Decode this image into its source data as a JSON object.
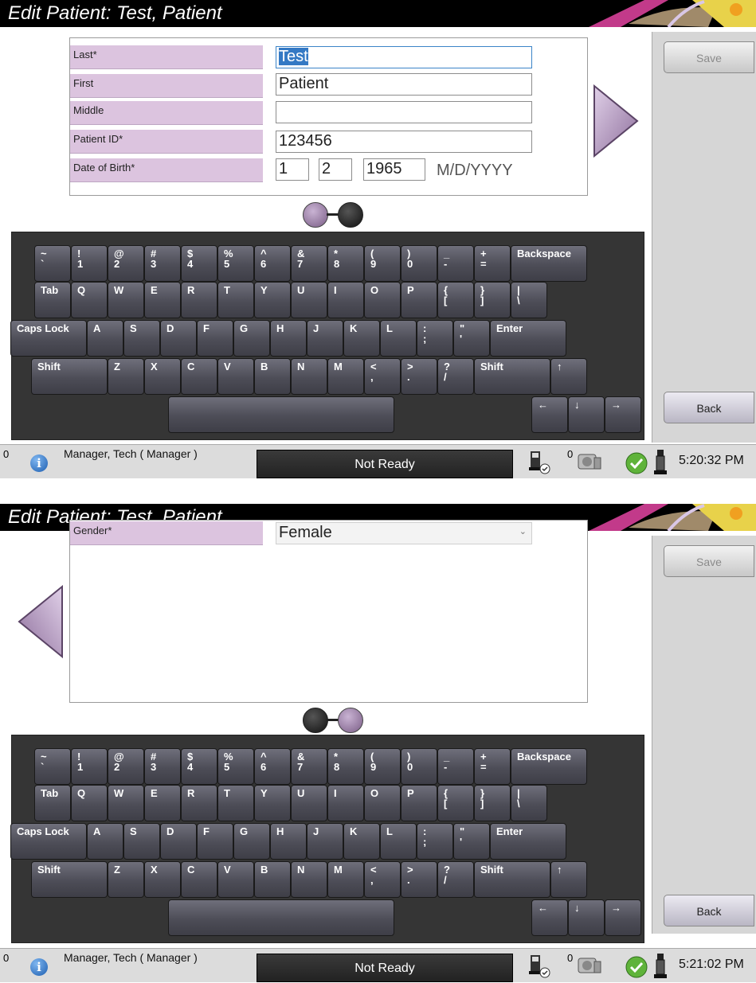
{
  "screens": [
    {
      "title": "Edit Patient: Test, Patient",
      "save_label": "Save",
      "back_label": "Back",
      "fields": [
        {
          "label": "Last*",
          "value": "Test"
        },
        {
          "label": "First",
          "value": "Patient"
        },
        {
          "label": "Middle",
          "value": ""
        },
        {
          "label": "Patient ID*",
          "value": "123456"
        }
      ],
      "dob": {
        "label": "Date of Birth*",
        "month": "1",
        "day": "2",
        "year": "1965",
        "format": "M/D/YYYY"
      },
      "page_indicator": {
        "current": 1,
        "total": 2
      },
      "status": {
        "count_left": "0",
        "user": "Manager, Tech ( Manager )",
        "state": "Not Ready",
        "count_right": "0",
        "time": "5:20:32 PM"
      }
    },
    {
      "title": "Edit Patient: Test, Patient",
      "save_label": "Save",
      "back_label": "Back",
      "gender": {
        "label": "Gender*",
        "value": "Female"
      },
      "page_indicator": {
        "current": 2,
        "total": 2
      },
      "status": {
        "count_left": "0",
        "user": "Manager, Tech ( Manager )",
        "state": "Not Ready",
        "count_right": "0",
        "time": "5:21:02 PM"
      }
    }
  ],
  "keyboard": {
    "rows": [
      [
        [
          "~",
          "`"
        ],
        [
          "!",
          "1"
        ],
        [
          "@",
          "2"
        ],
        [
          "#",
          "3"
        ],
        [
          "$",
          "4"
        ],
        [
          "%",
          "5"
        ],
        [
          "^",
          "6"
        ],
        [
          "&",
          "7"
        ],
        [
          "*",
          "8"
        ],
        [
          "(",
          "9"
        ],
        [
          ")",
          "0"
        ],
        [
          "_",
          "-"
        ],
        [
          "+",
          "="
        ],
        [
          "Backspace"
        ]
      ],
      [
        [
          "Tab"
        ],
        [
          "Q"
        ],
        [
          "W"
        ],
        [
          "E"
        ],
        [
          "R"
        ],
        [
          "T"
        ],
        [
          "Y"
        ],
        [
          "U"
        ],
        [
          "I"
        ],
        [
          "O"
        ],
        [
          "P"
        ],
        [
          "{",
          "["
        ],
        [
          "}",
          "]"
        ],
        [
          "|",
          "\\"
        ]
      ],
      [
        [
          "Caps Lock"
        ],
        [
          "A"
        ],
        [
          "S"
        ],
        [
          "D"
        ],
        [
          "F"
        ],
        [
          "G"
        ],
        [
          "H"
        ],
        [
          "J"
        ],
        [
          "K"
        ],
        [
          "L"
        ],
        [
          ":",
          ";"
        ],
        [
          "\"",
          "'"
        ],
        [
          "Enter"
        ]
      ],
      [
        [
          "Shift"
        ],
        [
          "Z"
        ],
        [
          "X"
        ],
        [
          "C"
        ],
        [
          "V"
        ],
        [
          "B"
        ],
        [
          "N"
        ],
        [
          "M"
        ],
        [
          "<",
          ","
        ],
        [
          ">",
          "."
        ],
        [
          "?",
          "/"
        ],
        [
          "Shift"
        ],
        [
          "↑"
        ]
      ],
      [
        [
          ""
        ],
        [
          "←"
        ],
        [
          "↓"
        ],
        [
          "→"
        ]
      ]
    ]
  },
  "colors": {
    "label_bg": "#dcc4df",
    "accent_purple": "#a48bb0",
    "titlebar": "#000000",
    "selection": "#3479c4"
  }
}
